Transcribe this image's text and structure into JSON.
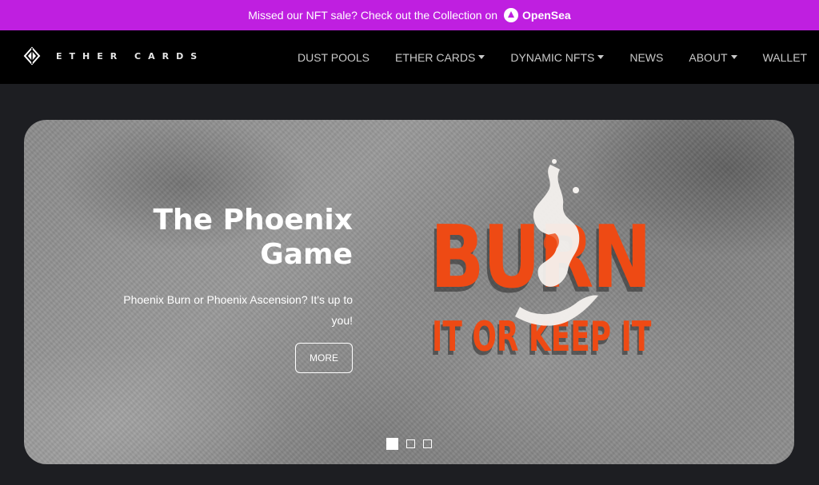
{
  "promo": {
    "text": "Missed our NFT sale? Check out the Collection on",
    "link_label": "OpenSea",
    "icon": "opensea-icon",
    "background": "#bf1fe0"
  },
  "brand": {
    "name": "ETHER CARDS",
    "logo_icon": "ether-cards-diamond-logo"
  },
  "nav": {
    "items": [
      {
        "label": "DUST POOLS",
        "dropdown": false
      },
      {
        "label": "ETHER CARDS",
        "dropdown": true
      },
      {
        "label": "DYNAMIC NFTS",
        "dropdown": true
      },
      {
        "label": "NEWS",
        "dropdown": false
      },
      {
        "label": "ABOUT",
        "dropdown": true
      },
      {
        "label": "WALLET",
        "dropdown": false
      }
    ]
  },
  "hero": {
    "title_line1": "The Phoenix",
    "title_line2": "Game",
    "subtitle_line1": "Phoenix Burn or Phoenix Ascension? It's up to",
    "subtitle_line2": "you!",
    "button_label": "MORE",
    "art": {
      "headline": "BURN",
      "tagline": "IT OR KEEP IT",
      "accent_color": "#ee4a14"
    },
    "slides": {
      "count": 3,
      "active_index": 0
    }
  }
}
